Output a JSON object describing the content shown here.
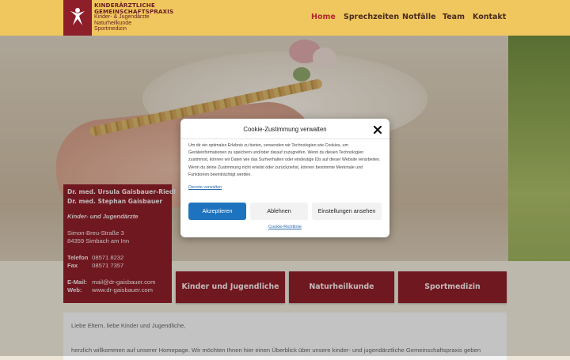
{
  "logo": {
    "line1": "KINDERÄRZTLICHE",
    "line2": "GEMEINSCHAFTSPRAXIS",
    "line3": "Kinder- & Jugendärzte",
    "line4": "Naturheilkunde",
    "line5": "Sportmedizin"
  },
  "nav": {
    "items": [
      {
        "label": "Home",
        "active": true
      },
      {
        "label": "Sprechzeiten",
        "active": false
      },
      {
        "label": "Notfälle",
        "active": false
      },
      {
        "label": "Team",
        "active": false
      },
      {
        "label": "Kontakt",
        "active": false
      }
    ]
  },
  "contact": {
    "doctor1": "Dr. med. Ursula Gaisbauer-Riedl",
    "doctor2": "Dr. med. Stephan Gaisbauer",
    "specialty": "Kinder- und Jugendärzte",
    "street": "Simon-Breu-Straße 3",
    "city": "84359 Simbach am Inn",
    "phone_label": "Telefon",
    "phone": "08571 8232",
    "fax_label": "Fax",
    "fax": "08571 7357",
    "email_label": "E-Mail:",
    "email": "mail@dr-gaisbauer.com",
    "web_label": "Web:",
    "web": "www.dr-gaisbauer.com"
  },
  "tiles": [
    {
      "label": "Kinder und Jugendliche"
    },
    {
      "label": "Naturheilkunde"
    },
    {
      "label": "Sportmedizin"
    }
  ],
  "content": {
    "greeting": "Liebe Eltern, liebe Kinder und Jugendliche,",
    "intro": "herzlich willkommen auf unserer Homepage. Wir möchten Ihnen hier einen Überblick über unsere kinder- und jugendärztliche Gemeinschaftspraxis geben"
  },
  "cookie": {
    "title": "Cookie-Zustimmung verwalten",
    "body": "Um dir ein optimales Erlebnis zu bieten, verwenden wir Technologien wie Cookies, um Geräteinformationen zu speichern und/oder darauf zuzugreifen. Wenn du diesen Technologien zustimmst, können wir Daten wie das Surfverhalten oder eindeutige IDs auf dieser Website verarbeiten. Wenn du deine Zustimmung nicht erteilst oder zurückziehst, können bestimmte Merkmale und Funktionen beeinträchtigt werden.",
    "services_link": "Dienste verwalten",
    "accept": "Akzeptieren",
    "decline": "Ablehnen",
    "settings": "Einstellungen ansehen",
    "policy": "Cookie-Richtlinie"
  },
  "colors": {
    "header": "#efc75e",
    "brand": "#8c1f29",
    "accent_nav": "#b5262f",
    "primary_button": "#1e73be"
  }
}
